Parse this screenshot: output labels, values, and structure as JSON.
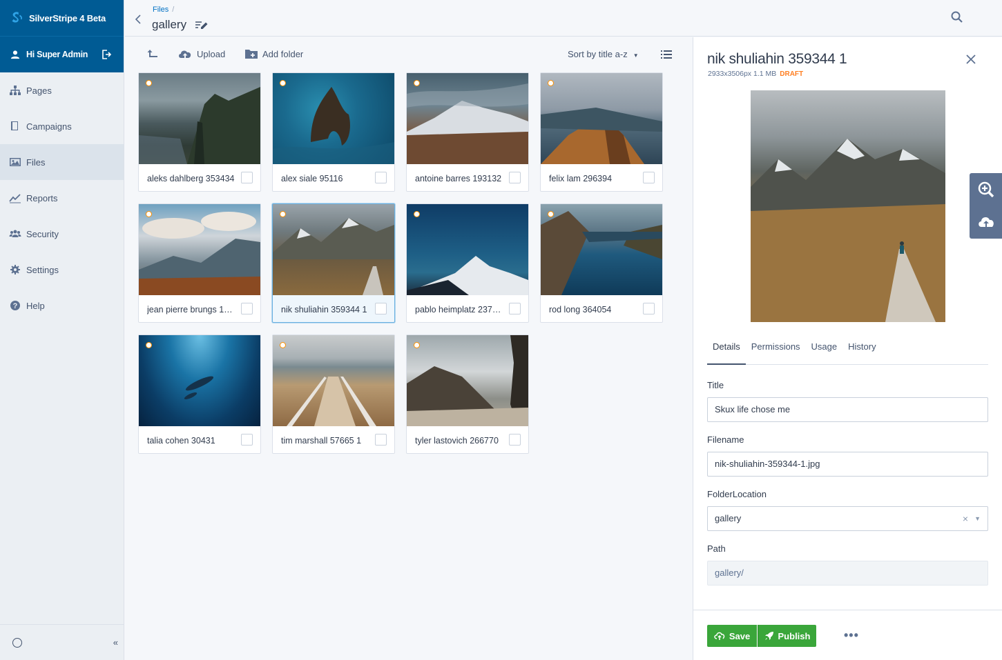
{
  "app": {
    "brand": "SilverStripe 4 Beta",
    "user_greeting": "Hi Super Admin"
  },
  "sidebar": {
    "items": [
      {
        "label": "Pages",
        "icon": "sitemap-icon",
        "active": false
      },
      {
        "label": "Campaigns",
        "icon": "book-icon",
        "active": false
      },
      {
        "label": "Files",
        "icon": "image-icon",
        "active": true
      },
      {
        "label": "Reports",
        "icon": "chart-line-icon",
        "active": false
      },
      {
        "label": "Security",
        "icon": "users-icon",
        "active": false
      },
      {
        "label": "Settings",
        "icon": "gear-icon",
        "active": false
      },
      {
        "label": "Help",
        "icon": "help-icon",
        "active": false
      }
    ],
    "collapse_label": "«"
  },
  "header": {
    "breadcrumb": "Files",
    "breadcrumb_sep": "/",
    "title": "gallery"
  },
  "toolbar": {
    "upload_label": "Upload",
    "add_folder_label": "Add folder",
    "sort_label": "Sort by title a-z"
  },
  "files": [
    {
      "label": "aleks dahlberg 353434",
      "selected": false
    },
    {
      "label": "alex siale 95116",
      "selected": false
    },
    {
      "label": "antoine barres 193132",
      "selected": false
    },
    {
      "label": "felix lam 296394",
      "selected": false
    },
    {
      "label": "jean pierre brungs 1…",
      "selected": false
    },
    {
      "label": "nik shuliahin 359344 1",
      "selected": true
    },
    {
      "label": "pablo heimplatz 237…",
      "selected": false
    },
    {
      "label": "rod long 364054",
      "selected": false
    },
    {
      "label": "talia cohen 30431",
      "selected": false
    },
    {
      "label": "tim marshall 57665 1",
      "selected": false
    },
    {
      "label": "tyler lastovich 266770",
      "selected": false
    }
  ],
  "detail": {
    "title": "nik shuliahin 359344 1",
    "meta": "2933x3506px 1.1 MB",
    "status": "DRAFT",
    "tabs": [
      "Details",
      "Permissions",
      "Usage",
      "History"
    ],
    "active_tab": "Details",
    "fields": {
      "title_label": "Title",
      "title_value": "Skux life chose me",
      "filename_label": "Filename",
      "filename_value": "nik-shuliahin-359344-1.jpg",
      "folder_label": "FolderLocation",
      "folder_value": "gallery",
      "folder_clear": "×",
      "path_label": "Path",
      "path_value": "gallery/"
    },
    "save_label": "Save",
    "publish_label": "Publish",
    "more_label": "•••"
  },
  "colors": {
    "brand": "#005b94",
    "accent": "#0071c4",
    "success": "#3aa63a",
    "draft": "#ff7f22"
  }
}
